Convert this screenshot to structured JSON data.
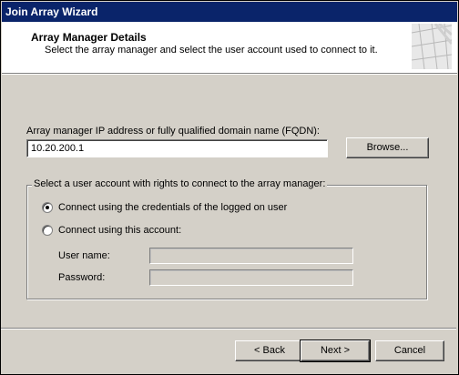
{
  "window": {
    "title": "Join Array Wizard"
  },
  "header": {
    "title": "Array Manager Details",
    "subtitle": "Select the array manager and select the user account used to connect to it."
  },
  "fqdn": {
    "label": "Array manager IP address or fully qualified domain name (FQDN):",
    "value": "10.20.200.1",
    "browse_label": "Browse..."
  },
  "account_group": {
    "legend": "Select a user account with rights to connect to the array manager:",
    "options": [
      {
        "label": "Connect using the credentials of the logged on user",
        "selected": true
      },
      {
        "label": "Connect using this account:",
        "selected": false
      }
    ],
    "username_label": "User name:",
    "password_label": "Password:"
  },
  "footer": {
    "back_label": "< Back",
    "next_label": "Next >",
    "cancel_label": "Cancel"
  }
}
